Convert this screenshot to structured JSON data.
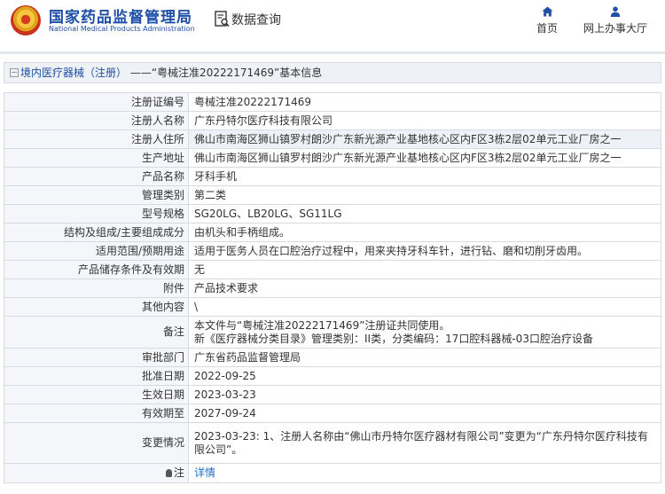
{
  "header": {
    "site_title": "国家药品监督管理局",
    "site_subtitle": "National Medical Products Administration",
    "data_query": "数据查询",
    "nav": {
      "home": "首页",
      "online_hall": "网上办事大厅"
    }
  },
  "breadcrumb": {
    "category": "境内医疗器械（注册）",
    "separator": "——",
    "title": "“粤械注准20222171469”基本信息"
  },
  "fields": [
    {
      "label": "注册证编号",
      "value": "粤械注准20222171469"
    },
    {
      "label": "注册人名称",
      "value": "广东丹特尔医疗科技有限公司"
    },
    {
      "label": "注册人住所",
      "value": "佛山市南海区狮山镇罗村朗沙广东新光源产业基地核心区内F区3栋2层02单元工业厂房之一"
    },
    {
      "label": "生产地址",
      "value": "佛山市南海区狮山镇罗村朗沙广东新光源产业基地核心区内F区3栋2层02单元工业厂房之一"
    },
    {
      "label": "产品名称",
      "value": "牙科手机"
    },
    {
      "label": "管理类别",
      "value": "第二类"
    },
    {
      "label": "型号规格",
      "value": "SG20LG、LB20LG、SG11LG"
    },
    {
      "label": "结构及组成/主要组成成分",
      "value": "由机头和手柄组成。"
    },
    {
      "label": "适用范围/预期用途",
      "value": "适用于医务人员在口腔治疗过程中，用来夹持牙科车针，进行钻、磨和切削牙齿用。"
    },
    {
      "label": "产品储存条件及有效期",
      "value": "无"
    },
    {
      "label": "附件",
      "value": "产品技术要求"
    },
    {
      "label": "其他内容",
      "value": "\\"
    }
  ],
  "note": {
    "label": "备注",
    "line1": "本文件与“粤械注准20222171469”注册证共同使用。",
    "line2": "新《医疗器械分类目录》管理类别：II类，分类编码：17口腔科器械-03口腔治疗设备"
  },
  "fields2": [
    {
      "label": "审批部门",
      "value": "广东省药品监督管理局"
    },
    {
      "label": "批准日期",
      "value": "2022-09-25"
    },
    {
      "label": "生效日期",
      "value": "2023-03-23"
    },
    {
      "label": "有效期至",
      "value": "2027-09-24"
    }
  ],
  "change": {
    "label": "变更情况",
    "value": "2023-03-23: 1、注册人名称由“佛山市丹特尔医疗器材有限公司”变更为“广东丹特尔医疗科技有限公司”。"
  },
  "footnote": {
    "label": "注",
    "link": "详情"
  },
  "colors": {
    "brand_blue": "#1f4ea6",
    "link_blue": "#1f6fc8",
    "label_bg": "#f4f6f9",
    "alt_row_bg": "#eef1f5",
    "border": "#d6dbe2"
  }
}
